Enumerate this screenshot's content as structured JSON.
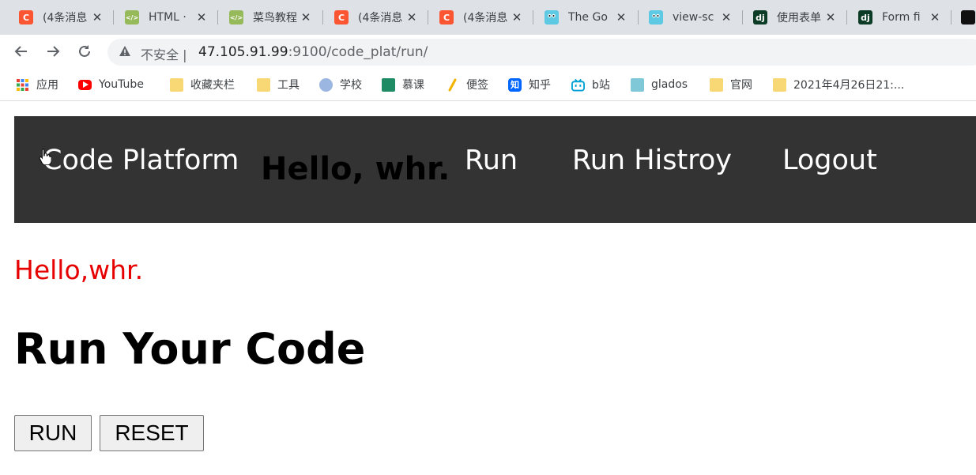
{
  "tabs": [
    {
      "title": "(4条消息",
      "favicon": "csdn-icon",
      "favicon_text": "C"
    },
    {
      "title": "HTML ·",
      "favicon": "runoob-icon",
      "favicon_text": "</>"
    },
    {
      "title": "菜鸟教程",
      "favicon": "runoob-icon",
      "favicon_text": "</>"
    },
    {
      "title": "(4条消息",
      "favicon": "csdn-icon",
      "favicon_text": "C"
    },
    {
      "title": "(4条消息",
      "favicon": "csdn-icon",
      "favicon_text": "C"
    },
    {
      "title": "The Go",
      "favicon": "gopher-icon",
      "favicon_text": ""
    },
    {
      "title": "view-sc",
      "favicon": "gopher-icon",
      "favicon_text": ""
    },
    {
      "title": "使用表单",
      "favicon": "django-icon",
      "favicon_text": "dj"
    },
    {
      "title": "Form fi",
      "favicon": "django-icon",
      "favicon_text": "dj"
    },
    {
      "title": "",
      "favicon": "dark-icon",
      "favicon_text": ""
    }
  ],
  "address_bar": {
    "security_label": "不安全",
    "url_host": "47.105.91.99",
    "url_rest": ":9100/code_plat/run/"
  },
  "bookmarks": [
    {
      "label": "应用",
      "icon": "apps-grid-icon"
    },
    {
      "label": "YouTube",
      "icon": "youtube-icon"
    },
    {
      "label": "收藏夹栏",
      "icon": "folder-icon"
    },
    {
      "label": "工具",
      "icon": "folder-icon"
    },
    {
      "label": "学校",
      "icon": "school-icon"
    },
    {
      "label": "慕课",
      "icon": "mooc-icon"
    },
    {
      "label": "便签",
      "icon": "note-icon"
    },
    {
      "label": "知乎",
      "icon": "zhihu-icon"
    },
    {
      "label": "b站",
      "icon": "bilibili-icon"
    },
    {
      "label": "glados",
      "icon": "glados-icon"
    },
    {
      "label": "官网",
      "icon": "folder-icon"
    },
    {
      "label": "2021年4月26日21:...",
      "icon": "folder-icon"
    }
  ],
  "page": {
    "nav": {
      "brand": "Code Platform",
      "hello": "Hello, whr.",
      "links": [
        "Run",
        "Run Histroy",
        "Logout"
      ]
    },
    "greeting": "Hello,whr.",
    "title": "Run Your Code",
    "buttons": {
      "run": "RUN",
      "reset": "RESET"
    }
  },
  "colors": {
    "nav_bg": "#333333",
    "greeting": "#e60000",
    "tabstrip_bg": "#dee1e6"
  }
}
